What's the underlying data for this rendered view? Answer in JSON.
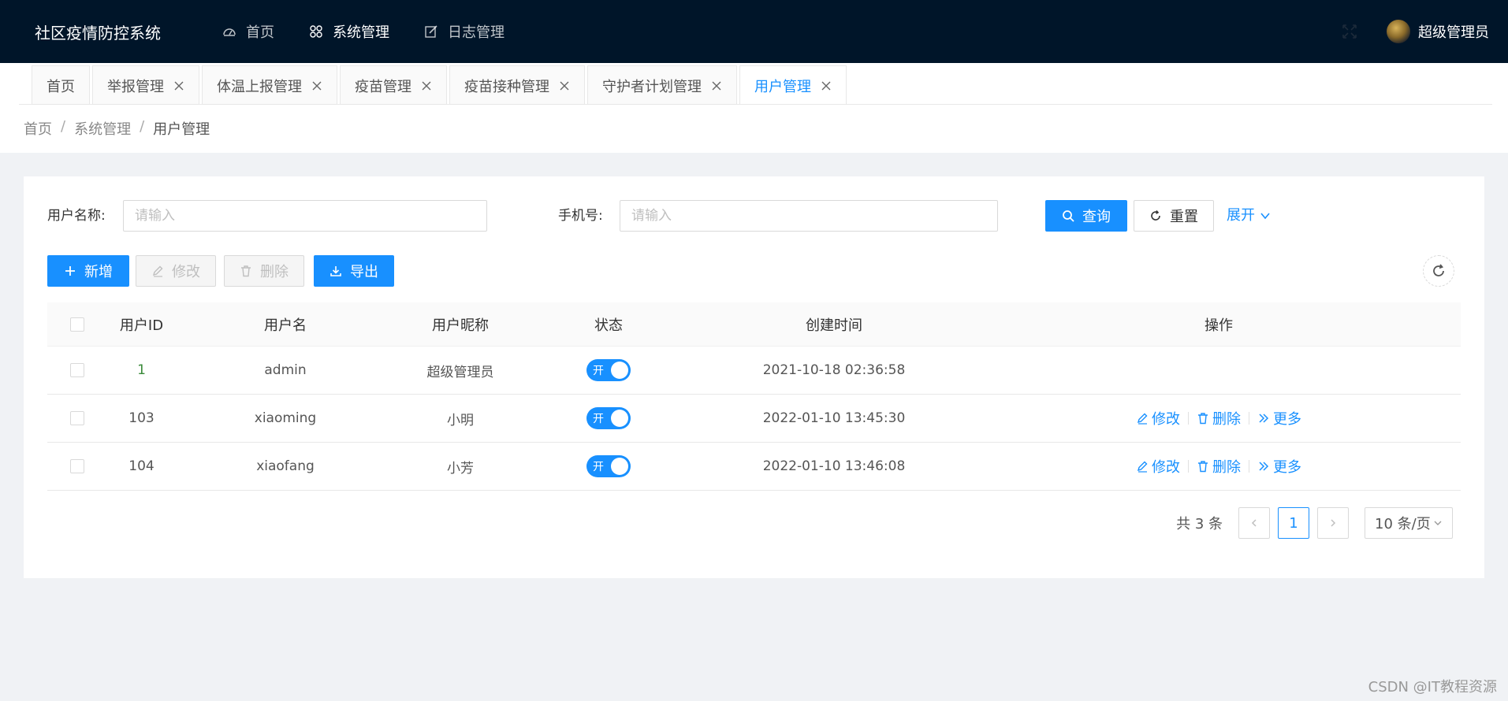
{
  "header": {
    "brand": "社区疫情防控系统",
    "nav": [
      {
        "label": "首页",
        "icon": "dashboard-icon"
      },
      {
        "label": "系统管理",
        "icon": "appstore-icon",
        "active": true
      },
      {
        "label": "日志管理",
        "icon": "edit-log-icon"
      }
    ],
    "user_name": "超级管理员"
  },
  "tabs": [
    {
      "label": "首页",
      "closable": false
    },
    {
      "label": "举报管理",
      "closable": true
    },
    {
      "label": "体温上报管理",
      "closable": true
    },
    {
      "label": "疫苗管理",
      "closable": true
    },
    {
      "label": "疫苗接种管理",
      "closable": true
    },
    {
      "label": "守护者计划管理",
      "closable": true
    },
    {
      "label": "用户管理",
      "closable": true,
      "active": true
    }
  ],
  "breadcrumb": [
    "首页",
    "系统管理",
    "用户管理"
  ],
  "search": {
    "username_label": "用户名称:",
    "username_placeholder": "请输入",
    "phone_label": "手机号:",
    "phone_placeholder": "请输入",
    "query_label": "查询",
    "reset_label": "重置",
    "expand_label": "展开"
  },
  "toolbar": {
    "add_label": "新增",
    "edit_label": "修改",
    "delete_label": "删除",
    "export_label": "导出"
  },
  "table": {
    "columns": [
      "用户ID",
      "用户名",
      "用户昵称",
      "状态",
      "创建时间",
      "操作"
    ],
    "rows": [
      {
        "id": "1",
        "username": "admin",
        "nickname": "超级管理员",
        "status": "开",
        "created": "2021-10-18 02:36:58",
        "actions": false
      },
      {
        "id": "103",
        "username": "xiaoming",
        "nickname": "小明",
        "status": "开",
        "created": "2022-01-10 13:45:30",
        "actions": true
      },
      {
        "id": "104",
        "username": "xiaofang",
        "nickname": "小芳",
        "status": "开",
        "created": "2022-01-10 13:46:08",
        "actions": true
      }
    ],
    "op_edit": "修改",
    "op_delete": "删除",
    "op_more": "更多"
  },
  "pagination": {
    "total_text": "共 3 条",
    "current_page": "1",
    "page_size": "10 条/页"
  },
  "watermark": "CSDN @IT教程资源",
  "colors": {
    "header_bg": "#001529",
    "primary": "#1890ff",
    "page_bg": "#f0f2f5"
  }
}
